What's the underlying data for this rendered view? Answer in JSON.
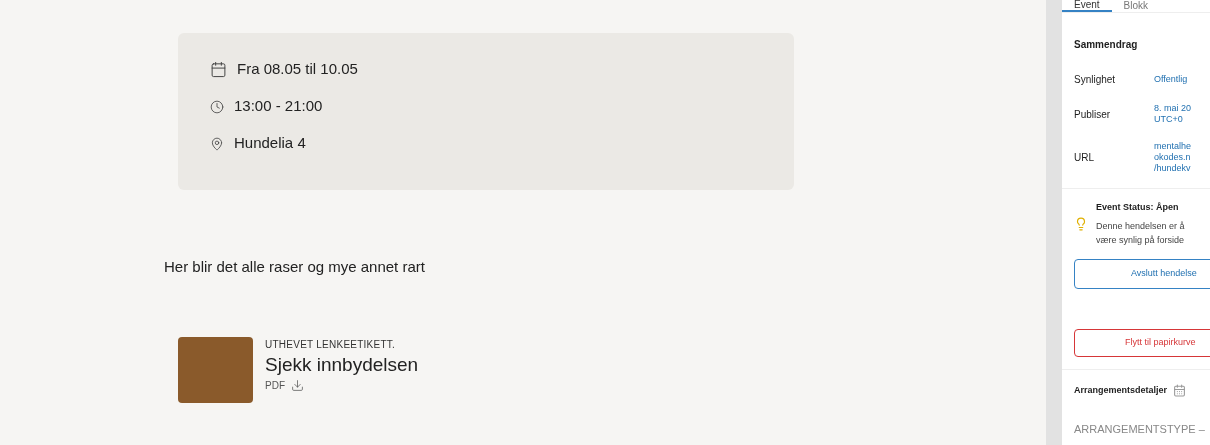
{
  "event_info": [
    {
      "kind": "date",
      "text": "Fra 08.05 til 10.05"
    },
    {
      "kind": "time",
      "text": "13:00 - 21:00"
    },
    {
      "kind": "location",
      "text": "Hundelia 4"
    }
  ],
  "description": "Her blir det alle raser og mye annet rart",
  "link_card": {
    "eyebrow": "UTHEVET LENKEETIKETT.",
    "title": "Sjekk innbydelsen",
    "file_type": "PDF"
  },
  "sidebar": {
    "tabs": [
      {
        "label": "Event",
        "selected": true
      },
      {
        "label": "Blokk",
        "selected": false
      }
    ],
    "summary_title": "Sammendrag",
    "rows": [
      {
        "label": "Synlighet",
        "value": [
          "Offentlig"
        ]
      },
      {
        "label": "Publiser",
        "value": [
          "8. mai 20",
          "UTC+0"
        ]
      },
      {
        "label": "URL",
        "value": [
          "mentalhe",
          "okodes.n",
          "/hundekv"
        ]
      }
    ],
    "status": {
      "title": "Event Status: Åpen",
      "text": [
        "Denne hendelsen er å",
        "være synlig på forside"
      ]
    },
    "end_button": "Avslutt hendelse",
    "trash_button": "Flytt til papirkurve",
    "details_title": "Arrangementsdetaljer",
    "type_label": "ARRANGEMENTSTYPE –"
  }
}
